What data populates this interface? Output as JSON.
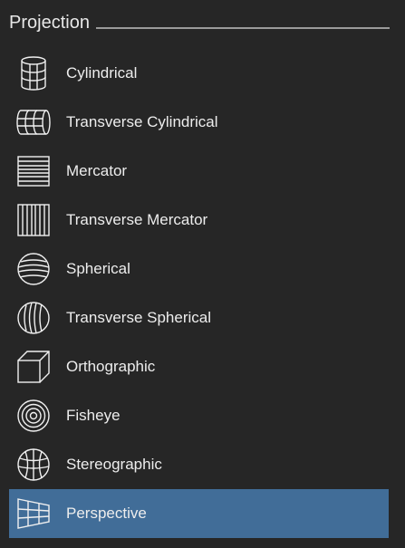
{
  "panel": {
    "title": "Projection"
  },
  "items": [
    {
      "label": "Cylindrical",
      "icon": "cylinder-icon",
      "selected": false
    },
    {
      "label": "Transverse Cylindrical",
      "icon": "transverse-cylinder-icon",
      "selected": false
    },
    {
      "label": "Mercator",
      "icon": "mercator-icon",
      "selected": false
    },
    {
      "label": "Transverse Mercator",
      "icon": "transverse-mercator-icon",
      "selected": false
    },
    {
      "label": "Spherical",
      "icon": "sphere-icon",
      "selected": false
    },
    {
      "label": "Transverse Spherical",
      "icon": "transverse-sphere-icon",
      "selected": false
    },
    {
      "label": "Orthographic",
      "icon": "cube-icon",
      "selected": false
    },
    {
      "label": "Fisheye",
      "icon": "fisheye-icon",
      "selected": false
    },
    {
      "label": "Stereographic",
      "icon": "stereographic-icon",
      "selected": false
    },
    {
      "label": "Perspective",
      "icon": "perspective-icon",
      "selected": true
    }
  ],
  "colors": {
    "background": "#262626",
    "selected": "#416d98",
    "text": "#ededed"
  }
}
